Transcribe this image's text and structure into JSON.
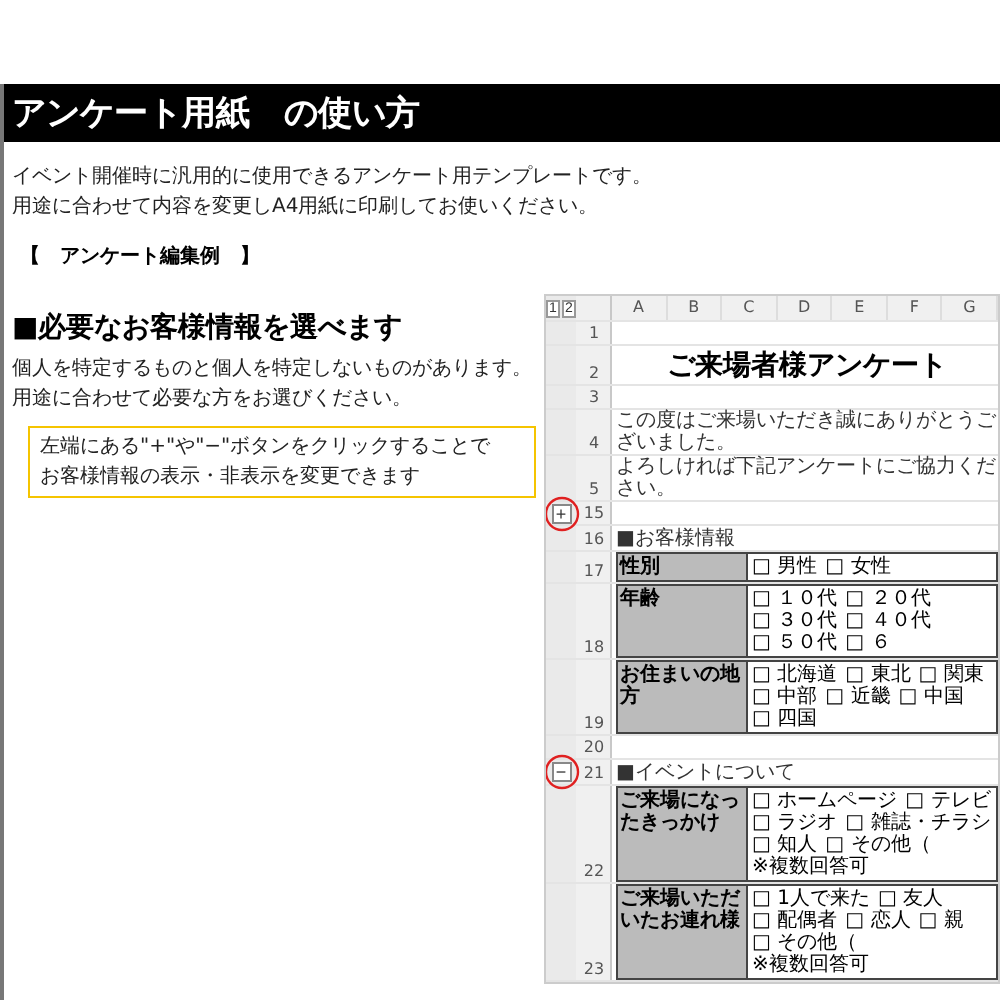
{
  "title": "アンケート用紙　の使い方",
  "intro": [
    "イベント開催時に汎用的に使用できるアンケート用テンプレートです。",
    "用途に合わせて内容を変更しA4用紙に印刷してお使いください。"
  ],
  "section_label": "【　アンケート編集例　】",
  "heading": "■必要なお客様情報を選べます",
  "body": [
    "個人を特定するものと個人を特定しないものがあります。",
    "用途に合わせて必要な方をお選びください。"
  ],
  "note": [
    "左端にある\"+\"や\"−\"ボタンをクリックすることで",
    "お客様情報の表示・非表示を変更できます"
  ],
  "sheet": {
    "levels": [
      "1",
      "2"
    ],
    "columns": [
      "A",
      "B",
      "C",
      "D",
      "E",
      "F",
      "G"
    ],
    "rows": [
      {
        "number": "1",
        "kind": "blank"
      },
      {
        "number": "2",
        "kind": "title",
        "text": "ご来場者様アンケート"
      },
      {
        "number": "3",
        "kind": "blank"
      },
      {
        "number": "4",
        "kind": "text",
        "text": "この度はご来場いただき誠にありがとうございました。"
      },
      {
        "number": "5",
        "kind": "text",
        "text": "よろしければ下記アンケートにご協力ください。"
      },
      {
        "number": "15",
        "kind": "blank",
        "outline": "+"
      },
      {
        "number": "16",
        "kind": "text",
        "text": "■お客様情報"
      },
      {
        "number": "17",
        "kind": "table",
        "label": "性別",
        "options": [
          "□ 男性",
          "□ 女性"
        ]
      },
      {
        "number": "18",
        "kind": "table",
        "label": "年齢",
        "options": [
          "□ １０代",
          "□ ２０代",
          "□ ３０代",
          "□ ４０代",
          "□ ５０代",
          "□ ６"
        ]
      },
      {
        "number": "19",
        "kind": "table",
        "label": "お住まいの地方",
        "options": [
          "□ 北海道",
          "□ 東北",
          "□ 関東",
          "□ 中部",
          "□ 近畿",
          "□ 中国",
          "□ 四国"
        ]
      },
      {
        "number": "20",
        "kind": "blank"
      },
      {
        "number": "21",
        "kind": "text",
        "text": "■イベントについて",
        "outline": "−"
      },
      {
        "number": "22",
        "kind": "table",
        "label": "ご来場になったきっかけ",
        "options": [
          "□ ホームページ",
          "□ テレビ",
          "□ ラジオ",
          "□ 雑誌・チラシ",
          "□ 知人",
          "□ その他（"
        ],
        "note": "※複数回答可"
      },
      {
        "number": "23",
        "kind": "table",
        "label": "ご来場いただいたお連れ様",
        "options": [
          "□ 1人で来た",
          "□ 友人",
          "□ 配偶者",
          "□ 恋人",
          "□ 親",
          "□ その他（"
        ],
        "note": "※複数回答可"
      }
    ]
  }
}
